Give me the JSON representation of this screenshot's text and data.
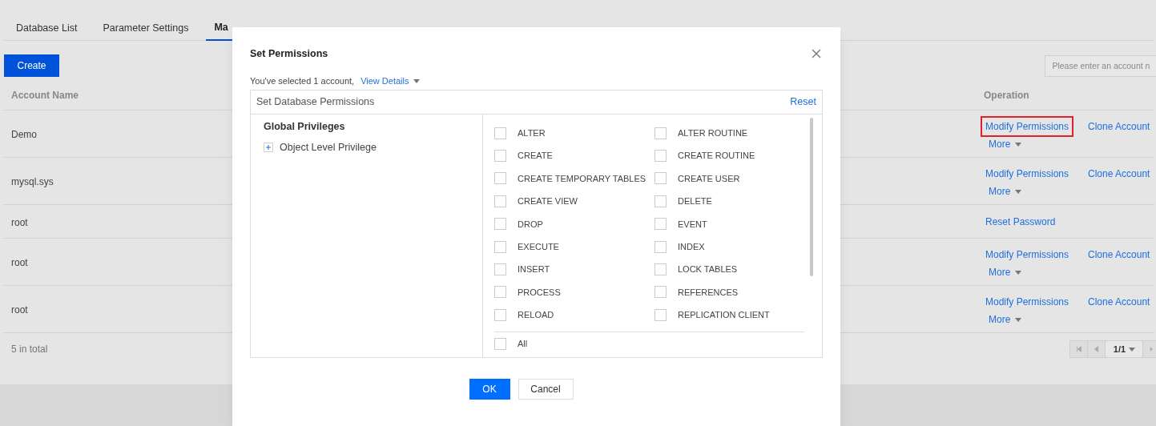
{
  "tabs": [
    {
      "label": "Database List",
      "selected": false
    },
    {
      "label": "Parameter Settings",
      "selected": false
    },
    {
      "label": "Ma",
      "selected": true
    }
  ],
  "create_button": "Create",
  "search": {
    "placeholder": "Please enter an account n"
  },
  "table": {
    "columns": [
      "Account Name",
      "Operation"
    ],
    "rows": [
      {
        "name": "Demo",
        "actions": [
          "Modify Permissions",
          "Clone Account"
        ],
        "more": "More",
        "highlighted": true
      },
      {
        "name": "mysql.sys",
        "actions": [
          "Modify Permissions",
          "Clone Account"
        ],
        "more": "More",
        "highlighted": false
      },
      {
        "name": "root",
        "actions": [
          "Reset Password"
        ],
        "highlighted": false
      },
      {
        "name": "root",
        "actions": [
          "Modify Permissions",
          "Clone Account"
        ],
        "more": "More",
        "highlighted": false
      },
      {
        "name": "root",
        "actions": [
          "Modify Permissions",
          "Clone Account"
        ],
        "more": "More",
        "highlighted": false
      }
    ]
  },
  "footer": {
    "total": "5 in total",
    "page": "1/1"
  },
  "dialog": {
    "title": "Set Permissions",
    "selected_text": "You've selected 1 account,",
    "details_link": "View Details",
    "panel_title": "Set Database Permissions",
    "reset": "Reset",
    "tree": {
      "heading": "Global Privileges",
      "items": [
        {
          "label": "Object Level Privilege",
          "expanded": false
        }
      ]
    },
    "privileges": [
      {
        "label": "ALTER",
        "checked": false
      },
      {
        "label": "ALTER ROUTINE",
        "checked": false
      },
      {
        "label": "CREATE",
        "checked": false
      },
      {
        "label": "CREATE ROUTINE",
        "checked": false
      },
      {
        "label": "CREATE TEMPORARY TABLES",
        "checked": false
      },
      {
        "label": "CREATE USER",
        "checked": false
      },
      {
        "label": "CREATE VIEW",
        "checked": false
      },
      {
        "label": "DELETE",
        "checked": false
      },
      {
        "label": "DROP",
        "checked": false
      },
      {
        "label": "EVENT",
        "checked": false
      },
      {
        "label": "EXECUTE",
        "checked": false
      },
      {
        "label": "INDEX",
        "checked": false
      },
      {
        "label": "INSERT",
        "checked": false
      },
      {
        "label": "LOCK TABLES",
        "checked": false
      },
      {
        "label": "PROCESS",
        "checked": false
      },
      {
        "label": "REFERENCES",
        "checked": false
      },
      {
        "label": "RELOAD",
        "checked": false
      },
      {
        "label": "REPLICATION CLIENT",
        "checked": false
      }
    ],
    "all": {
      "label": "All",
      "checked": false
    },
    "buttons": [
      {
        "label": "OK",
        "kind": "primary"
      },
      {
        "label": "Cancel",
        "kind": "secondary"
      }
    ]
  }
}
